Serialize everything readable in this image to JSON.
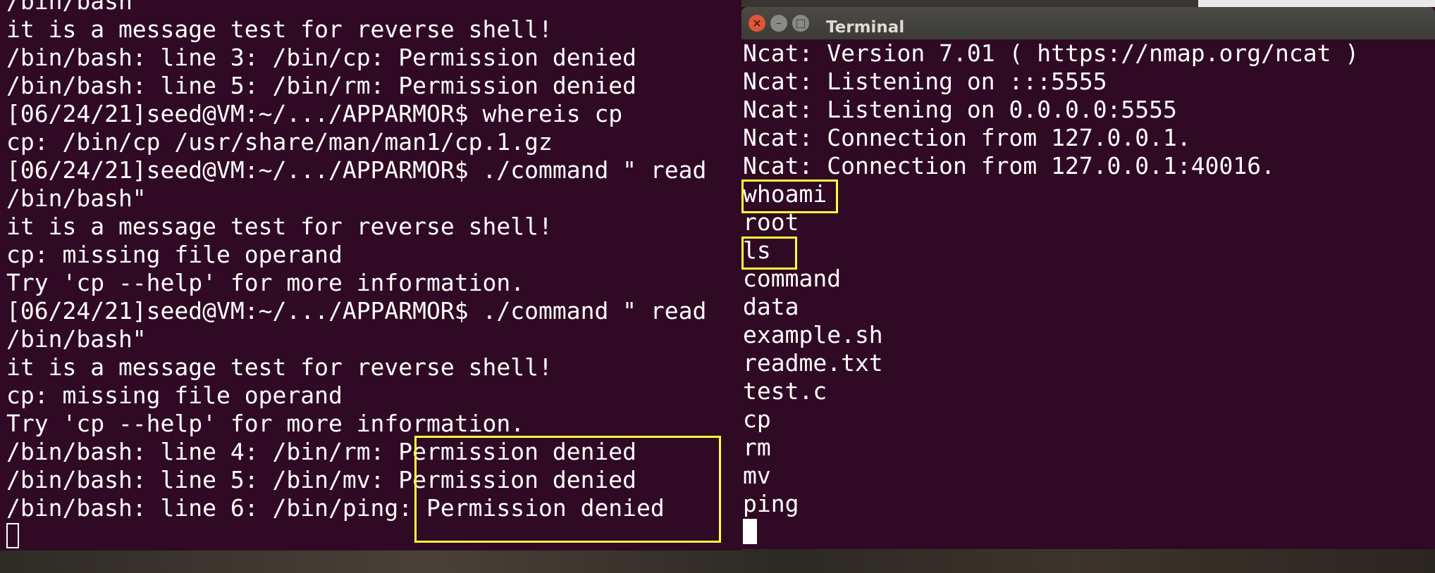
{
  "left_terminal": {
    "lines": [
      "/bin/bash",
      "it is a message test for reverse shell!",
      "/bin/bash: line 3: /bin/cp: Permission denied",
      "/bin/bash: line 5: /bin/rm: Permission denied",
      "[06/24/21]seed@VM:~/.../APPARMOR$ whereis cp",
      "cp: /bin/cp /usr/share/man/man1/cp.1.gz",
      "[06/24/21]seed@VM:~/.../APPARMOR$ ./command \" read",
      "/bin/bash\"",
      "it is a message test for reverse shell!",
      "cp: missing file operand",
      "Try 'cp --help' for more information.",
      "[06/24/21]seed@VM:~/.../APPARMOR$ ./command \" read",
      "/bin/bash\"",
      "it is a message test for reverse shell!",
      "cp: missing file operand",
      "Try 'cp --help' for more information.",
      "/bin/bash: line 4: /bin/rm: Permission denied",
      "/bin/bash: line 5: /bin/mv: Permission denied",
      "/bin/bash: line 6: /bin/ping: Permission denied"
    ]
  },
  "right_terminal": {
    "title": "Terminal",
    "close_glyph": "×",
    "min_glyph": "–",
    "max_glyph": "□",
    "lines": [
      "Ncat: Version 7.01 ( https://nmap.org/ncat )",
      "Ncat: Listening on :::5555",
      "Ncat: Listening on 0.0.0.0:5555",
      "Ncat: Connection from 127.0.0.1.",
      "Ncat: Connection from 127.0.0.1:40016.",
      "whoami",
      "root",
      "ls",
      "command",
      "data",
      "example.sh",
      "readme.txt",
      "test.c",
      "cp",
      "rm",
      "mv",
      "ping"
    ]
  },
  "colors": {
    "terminal_bg": "#300a24",
    "highlight": "#ffff3a",
    "text": "#ffffff"
  }
}
